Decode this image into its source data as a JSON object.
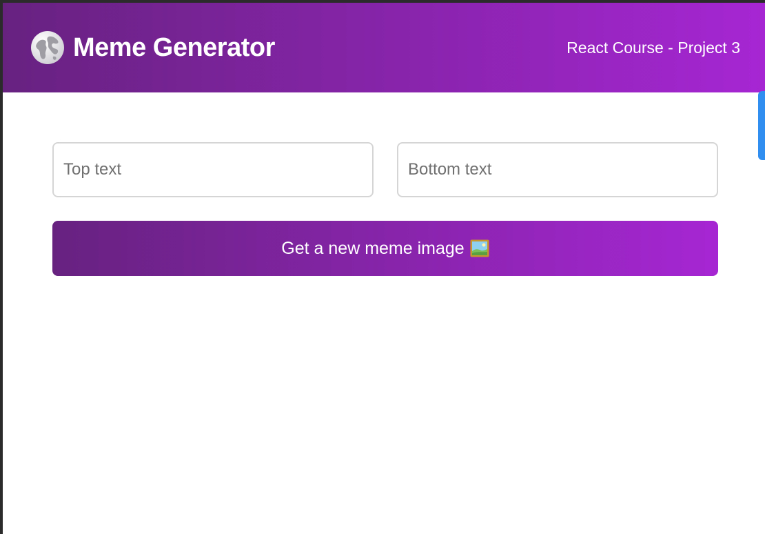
{
  "header": {
    "title": "Meme Generator",
    "subtitle": "React Course - Project 3",
    "logo_icon": "globe-icon"
  },
  "form": {
    "top_text": {
      "placeholder": "Top text",
      "value": ""
    },
    "bottom_text": {
      "placeholder": "Bottom text",
      "value": ""
    },
    "button_label": "Get a new meme image",
    "button_icon": "framed-picture-icon"
  },
  "colors": {
    "gradient_start": "#672280",
    "gradient_end": "#a626d3",
    "side_tab": "#2f8ef0"
  }
}
